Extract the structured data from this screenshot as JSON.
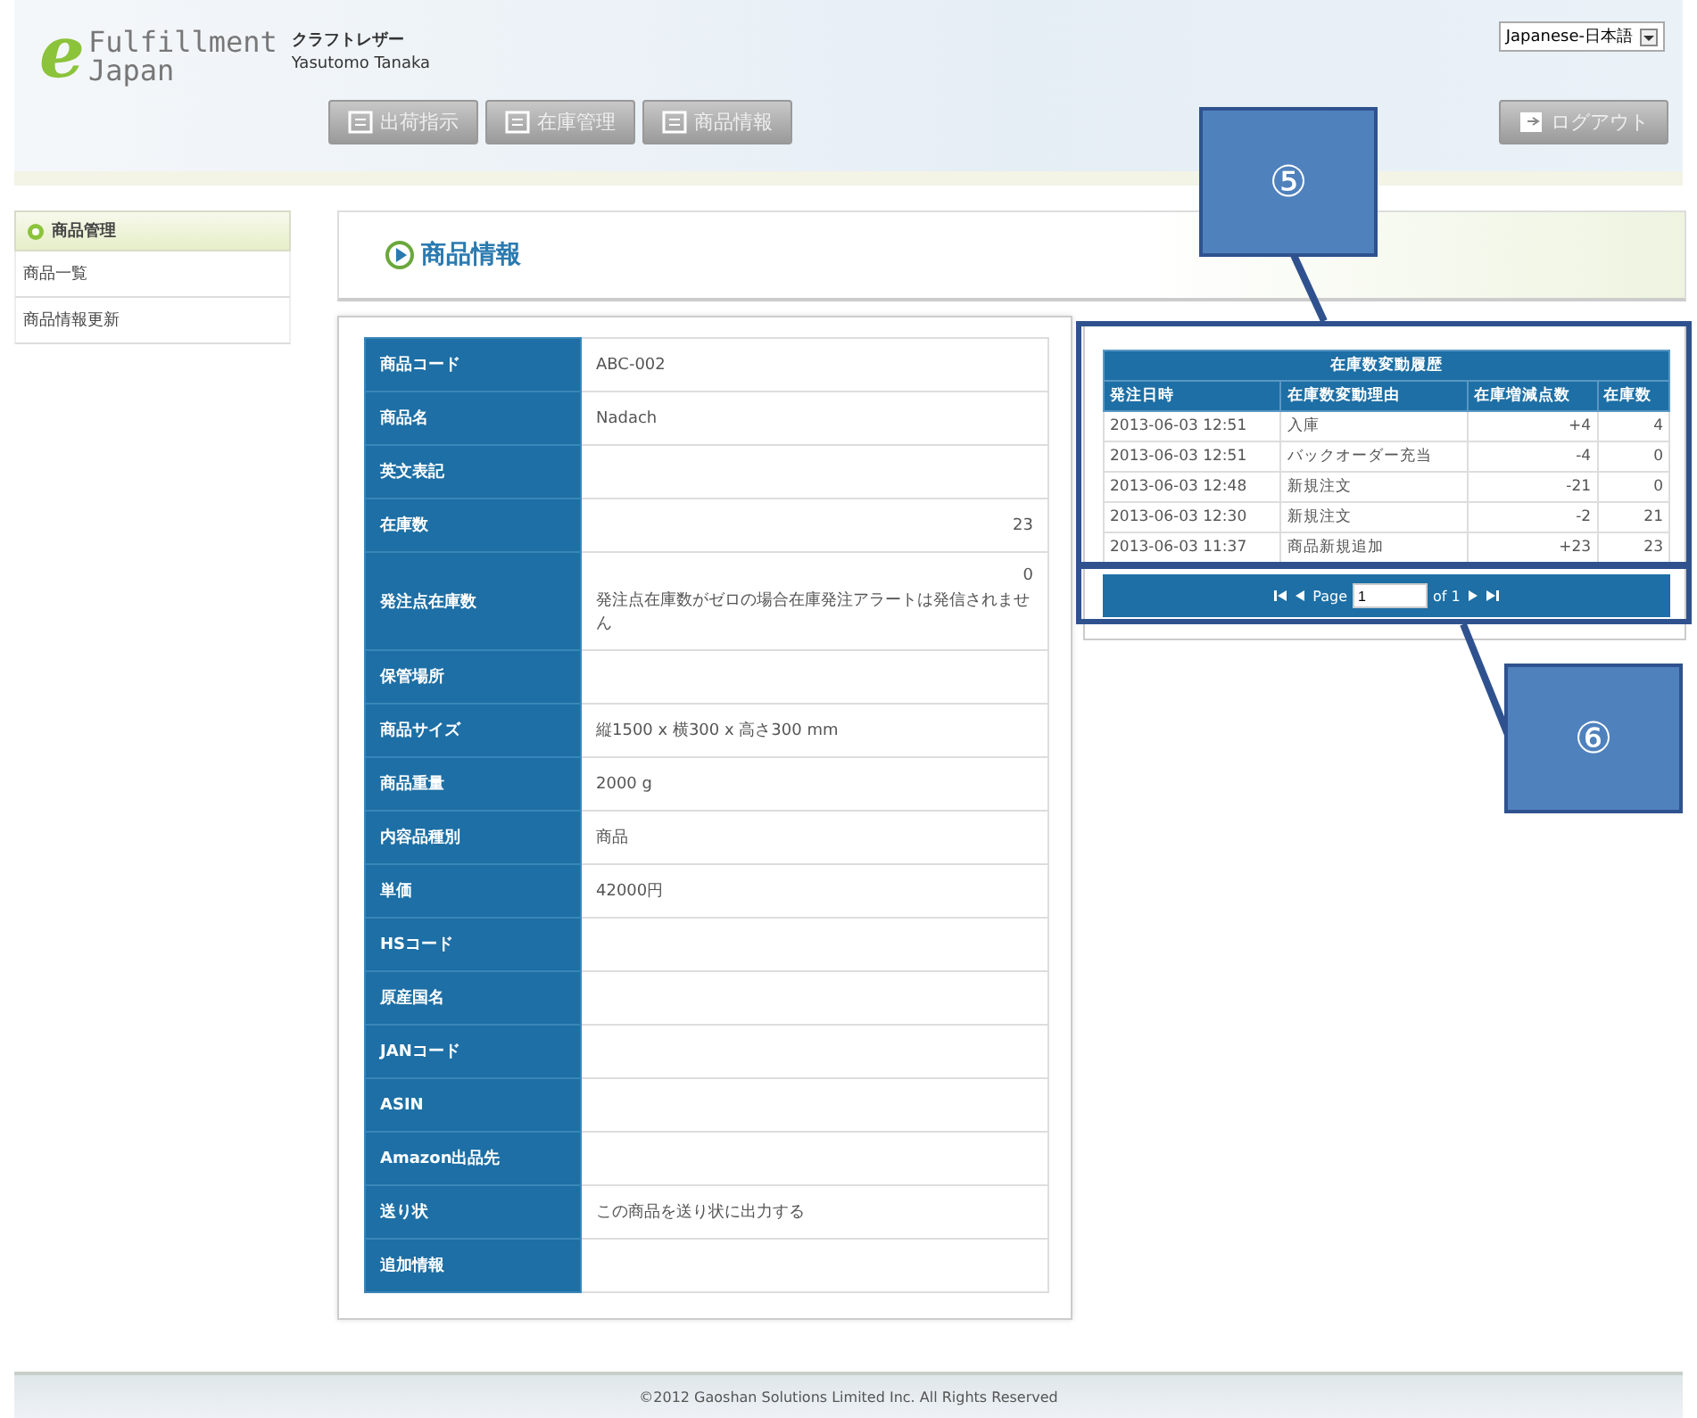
{
  "header": {
    "logo_letter": "e",
    "logo_brand": "Fulfillment",
    "logo_sub": "Japan",
    "company": "クラフトレザー",
    "user": "Yasutomo Tanaka",
    "language": "Japanese-日本語",
    "nav": [
      {
        "label": "出荷指示",
        "selected": false
      },
      {
        "label": "在庫管理",
        "selected": false
      },
      {
        "label": "商品情報",
        "selected": false
      }
    ],
    "logout": "ログアウト"
  },
  "sidebar": {
    "title": "商品管理",
    "items": [
      "商品一覧",
      "商品情報更新"
    ]
  },
  "page_title": "商品情報",
  "product_fields": [
    {
      "kind": "text",
      "label": "商品コード",
      "value": "ABC-002"
    },
    {
      "kind": "text",
      "label": "商品名",
      "value": "Nadach"
    },
    {
      "kind": "text",
      "label": "英文表記"
    },
    {
      "kind": "number",
      "label": "在庫数",
      "value": "23"
    },
    {
      "kind": "number_note",
      "label": "発注点在庫数",
      "value": "0",
      "note": "発注点在庫数がゼロの場合在庫発注アラートは発信されません"
    },
    {
      "kind": "text",
      "label": "保管場所"
    },
    {
      "kind": "text",
      "label": "商品サイズ",
      "value": "縦1500 x 横300 x 高さ300 mm"
    },
    {
      "kind": "text",
      "label": "商品重量",
      "value": "2000 g"
    },
    {
      "kind": "text",
      "label": "内容品種別",
      "value": "商品"
    },
    {
      "kind": "text",
      "label": "単価",
      "value": "42000円"
    },
    {
      "kind": "text",
      "label": "HSコード"
    },
    {
      "kind": "text",
      "label": "原産国名"
    },
    {
      "kind": "text",
      "label": "JANコード"
    },
    {
      "kind": "text",
      "label": "ASIN"
    },
    {
      "kind": "text",
      "label": "Amazon出品先"
    },
    {
      "kind": "text",
      "label": "送り状",
      "value": "この商品を送り状に出力する"
    },
    {
      "kind": "text",
      "label": "追加情報"
    }
  ],
  "history": {
    "title": "在庫数変動履歴",
    "columns": [
      "発注日時",
      "在庫数変動理由",
      "在庫増減点数",
      "在庫数"
    ],
    "rows": [
      [
        "2013-06-03 12:51",
        "入庫",
        "+4",
        "4"
      ],
      [
        "2013-06-03 12:51",
        "バックオーダー充当",
        "-4",
        "0"
      ],
      [
        "2013-06-03 12:48",
        "新規注文",
        "-21",
        "0"
      ],
      [
        "2013-06-03 12:30",
        "新規注文",
        "-2",
        "21"
      ],
      [
        "2013-06-03 11:37",
        "商品新規追加",
        "+23",
        "23"
      ]
    ],
    "pager": {
      "page_label": "Page",
      "page_value": "1",
      "of_label": "of 1"
    }
  },
  "callouts": [
    "⑤",
    "⑥"
  ],
  "footer": "©2012 Gaoshan Solutions Limited Inc. All Rights Reserved"
}
